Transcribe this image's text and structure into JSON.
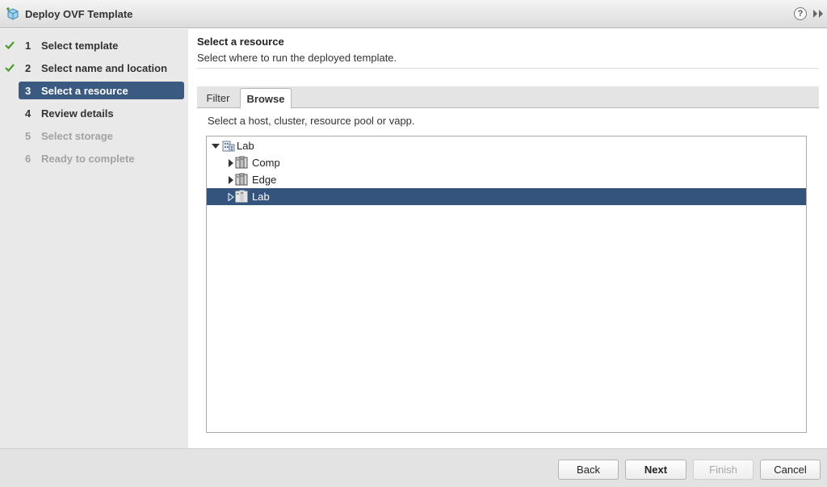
{
  "window": {
    "title": "Deploy OVF Template",
    "help_symbol": "?"
  },
  "steps": [
    {
      "number": "1",
      "label": "Select template",
      "state": "completed"
    },
    {
      "number": "2",
      "label": "Select name and location",
      "state": "completed"
    },
    {
      "number": "3",
      "label": "Select a resource",
      "state": "active"
    },
    {
      "number": "4",
      "label": "Review details",
      "state": "pending"
    },
    {
      "number": "5",
      "label": "Select storage",
      "state": "disabled"
    },
    {
      "number": "6",
      "label": "Ready to complete",
      "state": "disabled"
    }
  ],
  "section": {
    "title": "Select a resource",
    "subtitle": "Select where to run the deployed template."
  },
  "tabs": [
    {
      "label": "Filter",
      "active": false
    },
    {
      "label": "Browse",
      "active": true
    }
  ],
  "browse_hint": "Select a host, cluster, resource pool or vapp.",
  "tree": [
    {
      "label": "Lab",
      "icon": "datacenter-icon",
      "expanded": true,
      "selected": false,
      "level": 0
    },
    {
      "label": "Comp",
      "icon": "cluster-icon",
      "expanded": false,
      "selected": false,
      "level": 1
    },
    {
      "label": "Edge",
      "icon": "cluster-icon",
      "expanded": false,
      "selected": false,
      "level": 1
    },
    {
      "label": "Lab",
      "icon": "cluster-icon",
      "expanded": false,
      "selected": true,
      "level": 1
    }
  ],
  "buttons": {
    "back": "Back",
    "next": "Next",
    "finish": "Finish",
    "cancel": "Cancel"
  },
  "colors": {
    "active_step_bg": "#3b5a82",
    "selected_row_bg": "#34547e",
    "check_green": "#4a9a2c"
  }
}
